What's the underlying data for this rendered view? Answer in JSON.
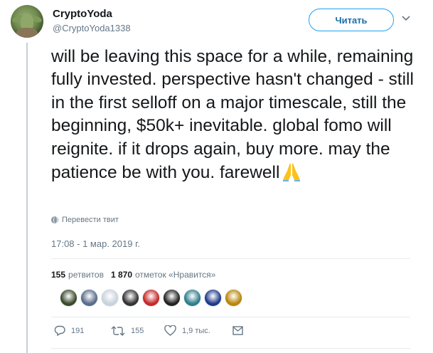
{
  "author": {
    "name": "CryptoYoda",
    "handle": "@CryptoYoda1338"
  },
  "follow_label": "Читать",
  "tweet_text": "will be leaving this space for a while, remaining fully invested. perspective hasn't changed - still in the first selloff on a major timescale, still the beginning, $50k+ inevitable. global fomo will reignite. if it drops again, buy more. may the patience be with you. farewell",
  "translate_label": "Перевести твит",
  "timestamp": "17:08 - 1 мар. 2019 г.",
  "stats": {
    "retweets_count": "155",
    "retweets_label": "ретвитов",
    "likes_count": "1 870",
    "likes_label": "отметок «Нравится»"
  },
  "liker_avatars": [
    {
      "color": "#3b4a2a"
    },
    {
      "color": "#5a6b8c"
    },
    {
      "color": "#c9d2dc"
    },
    {
      "color": "#333333"
    },
    {
      "color": "#c62828"
    },
    {
      "color": "#222222"
    },
    {
      "color": "#2e7d8c"
    },
    {
      "color": "#1e3a8a"
    },
    {
      "color": "#b8860b"
    }
  ],
  "actions": {
    "replies": "191",
    "retweets": "155",
    "likes": "1,9 тыс."
  },
  "icons": {
    "more": "chevron-down-icon",
    "translate": "globe-icon",
    "reply": "reply-icon",
    "retweet": "retweet-icon",
    "like": "heart-icon",
    "dm": "envelope-icon",
    "emoji": "folded-hands-emoji"
  },
  "colors": {
    "accent": "#1da1f2",
    "secondary_text": "#657786",
    "thread_line": "#c4cfd6"
  }
}
